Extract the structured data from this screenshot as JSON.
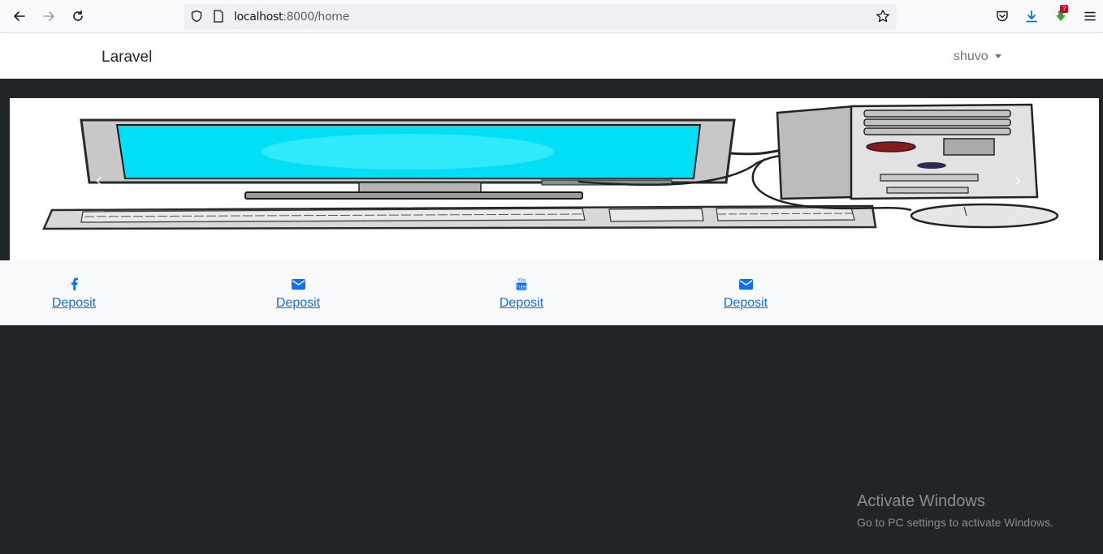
{
  "browser": {
    "url_host": "localhost",
    "url_path": ":8000/home",
    "download_badge": "?"
  },
  "navbar": {
    "brand": "Laravel",
    "user": "shuvo"
  },
  "carousel": {
    "prev": "‹",
    "next": "›"
  },
  "links": [
    {
      "icon": "facebook-icon",
      "label": "Deposit"
    },
    {
      "icon": "envelope-icon",
      "label": "Deposit"
    },
    {
      "icon": "youtube-icon",
      "label": "Deposit"
    },
    {
      "icon": "envelope-icon",
      "label": "Deposit"
    }
  ],
  "watermark": {
    "title": "Activate Windows",
    "subtitle": "Go to PC settings to activate Windows."
  },
  "colors": {
    "page_bg": "#212529",
    "link": "#0d6efd",
    "screen": "#00e5ff"
  }
}
